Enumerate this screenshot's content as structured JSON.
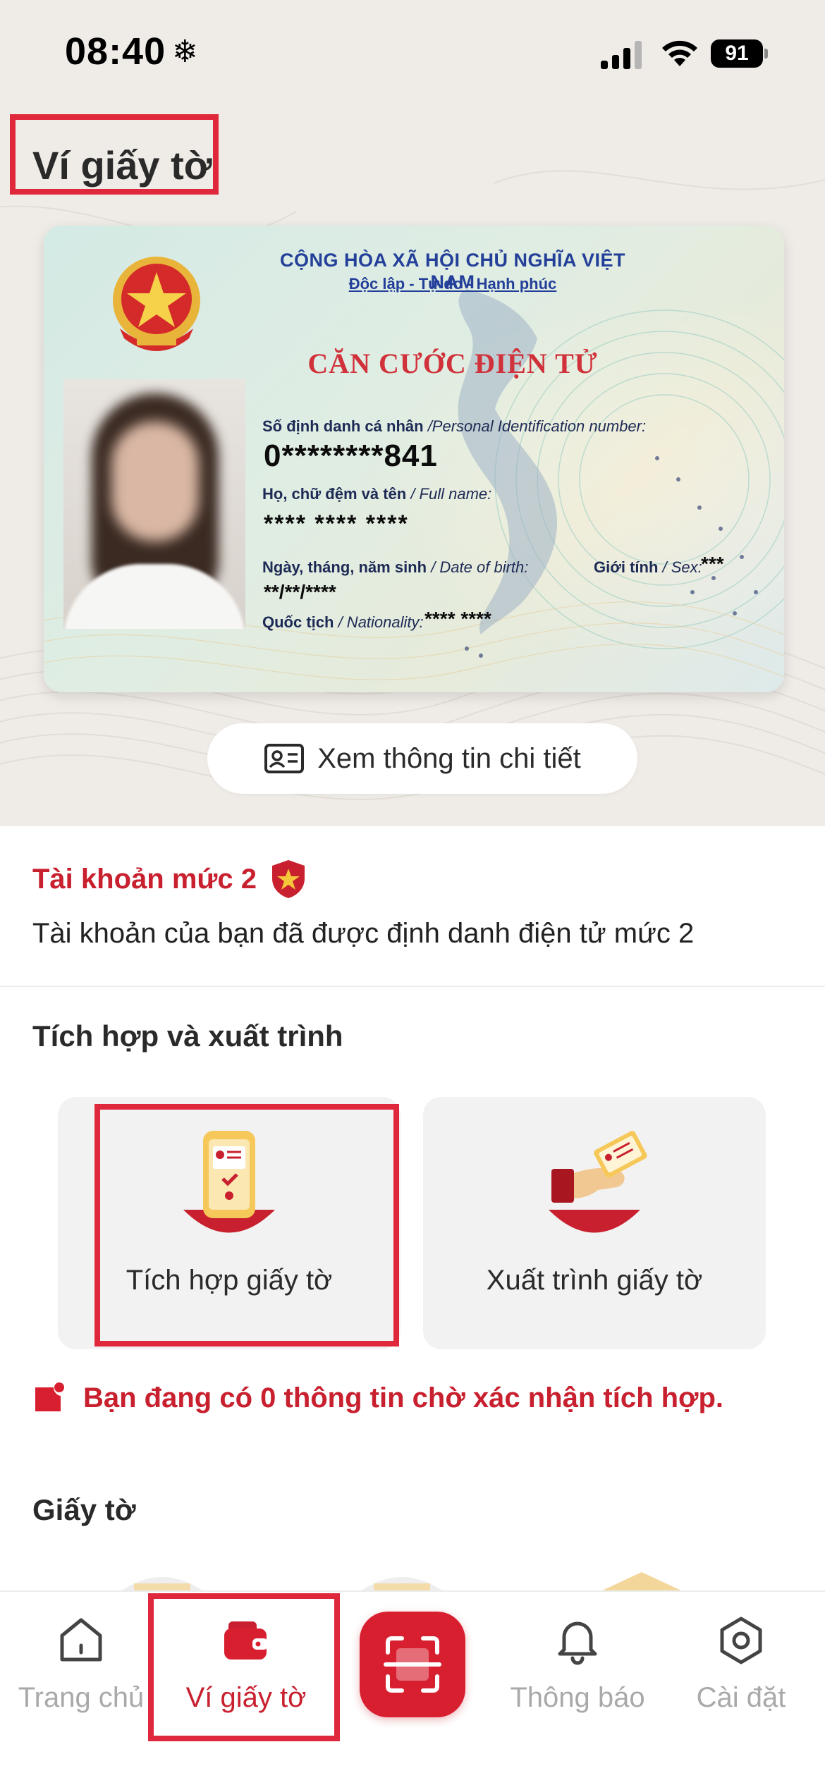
{
  "status_bar": {
    "time": "08:40",
    "snow_glyph": "❄",
    "battery": "91"
  },
  "page": {
    "title": "Ví giấy tờ"
  },
  "id_card": {
    "header_line1": "CỘNG HÒA XÃ HỘI CHỦ NGHĨA VIỆT NAM",
    "header_line2": "Độc lập - Tự do - Hạnh phúc",
    "card_title": "CĂN CƯỚC ĐIỆN TỬ",
    "id_label": "Số định danh cá nhân",
    "id_label_en": "/Personal Identification number:",
    "id_value": "0********841",
    "name_label": "Họ, chữ đệm và tên",
    "name_label_en": "/ Full name:",
    "name_value": "**** **** ****",
    "dob_label": "Ngày, tháng, năm sinh",
    "dob_label_en": "/ Date of birth:",
    "dob_value": "**/**/****",
    "sex_label": "Giới tính",
    "sex_label_en": "/ Sex:",
    "sex_value": "***",
    "nationality_label": "Quốc tịch",
    "nationality_label_en": "/ Nationality:",
    "nationality_value": "**** ****"
  },
  "detail_button": {
    "label": "Xem thông tin chi tiết",
    "icon": "id-card-icon"
  },
  "account": {
    "level_title": "Tài khoản mức 2",
    "level_icon": "shield-star-icon",
    "description": "Tài khoản của bạn đã được định danh điện tử mức 2"
  },
  "integration": {
    "section_title": "Tích hợp và xuất trình",
    "tiles": [
      {
        "label": "Tích hợp giấy tờ",
        "icon": "phone-document-icon"
      },
      {
        "label": "Xuất trình giấy tờ",
        "icon": "hand-card-icon"
      }
    ],
    "notice": "Bạn đang có 0 thông tin chờ xác nhận tích hợp.",
    "notice_icon": "notice-icon"
  },
  "documents": {
    "section_title": "Giấy tờ"
  },
  "bottom_nav": {
    "items": [
      {
        "label": "Trang chủ",
        "icon": "home-icon"
      },
      {
        "label": "Ví giấy tờ",
        "icon": "wallet-icon",
        "active": true
      },
      {
        "label": "",
        "icon": "scan-icon"
      },
      {
        "label": "Thông báo",
        "icon": "bell-icon"
      },
      {
        "label": "Cài đặt",
        "icon": "settings-icon"
      }
    ]
  },
  "colors": {
    "accent": "#c8202e",
    "highlight_box": "#e0283c",
    "top_background": "#efebe7",
    "card_blue_text": "#233f99",
    "card_red_title": "#d0313a"
  }
}
